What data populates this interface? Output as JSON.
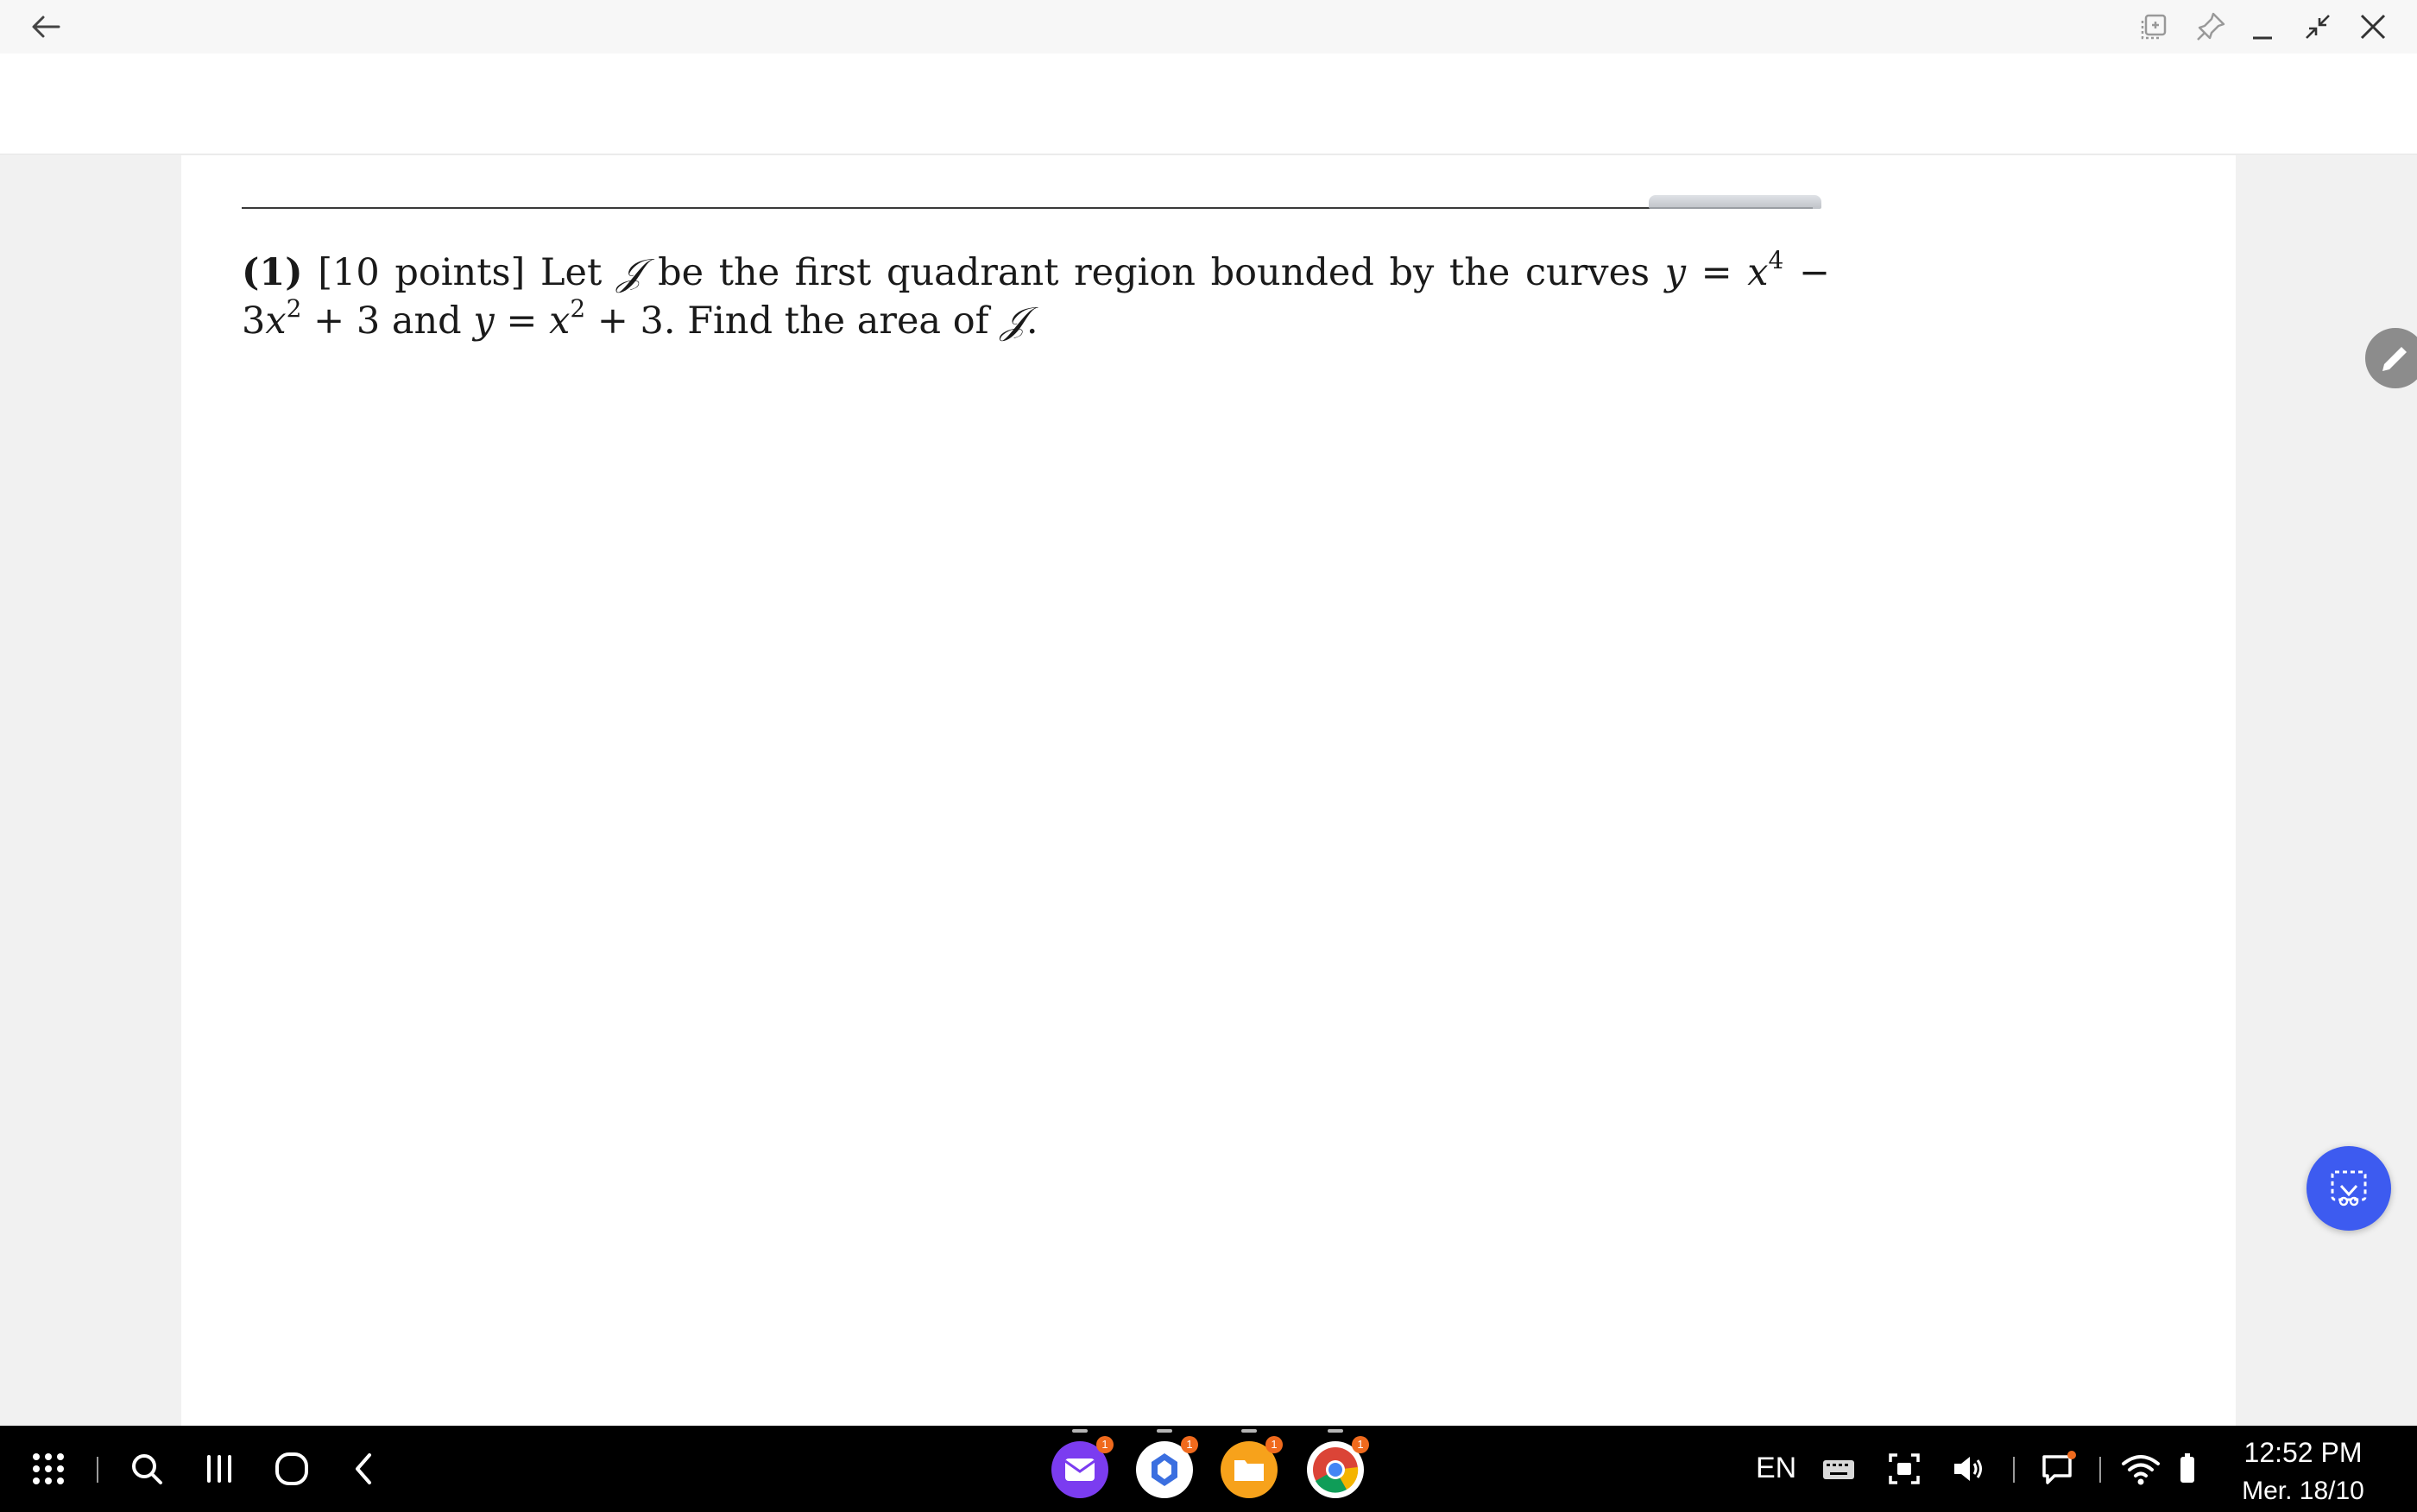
{
  "problem": {
    "number": "(1)",
    "points": "[10 points]",
    "text_1": " Let ",
    "region": "𝒥",
    "text_2": " be the first quadrant region bounded by the curves ",
    "curve1_y": "y",
    "curve1_eq": " = ",
    "curve1_x": "x",
    "curve1_exp1": "4",
    "curve1_mid": " − 3",
    "curve1_x2": "x",
    "curve1_exp2": "2",
    "curve1_end": " + 3",
    "text_3": " and ",
    "curve2_y": "y",
    "curve2_eq": " = ",
    "curve2_x": "x",
    "curve2_exp": "2",
    "curve2_end": " + 3. Find the area of ",
    "region_end": "𝒥",
    "period": "."
  },
  "taskbar": {
    "language": "EN",
    "time": "12:52 PM",
    "date": "Mer. 18/10",
    "apps": [
      {
        "name": "email-app",
        "badge": "1",
        "color": "#7b3cf0"
      },
      {
        "name": "copilot-app",
        "badge": "1",
        "color": "#ffffff"
      },
      {
        "name": "files-app",
        "badge": "1",
        "color": "#f7a21b"
      },
      {
        "name": "chrome-app",
        "badge": "1",
        "color": "#ffffff"
      }
    ]
  },
  "colors": {
    "capture_button": "#3d5bf0",
    "taskbar_bg": "#000000",
    "notification_dot": "#f06a1d"
  }
}
